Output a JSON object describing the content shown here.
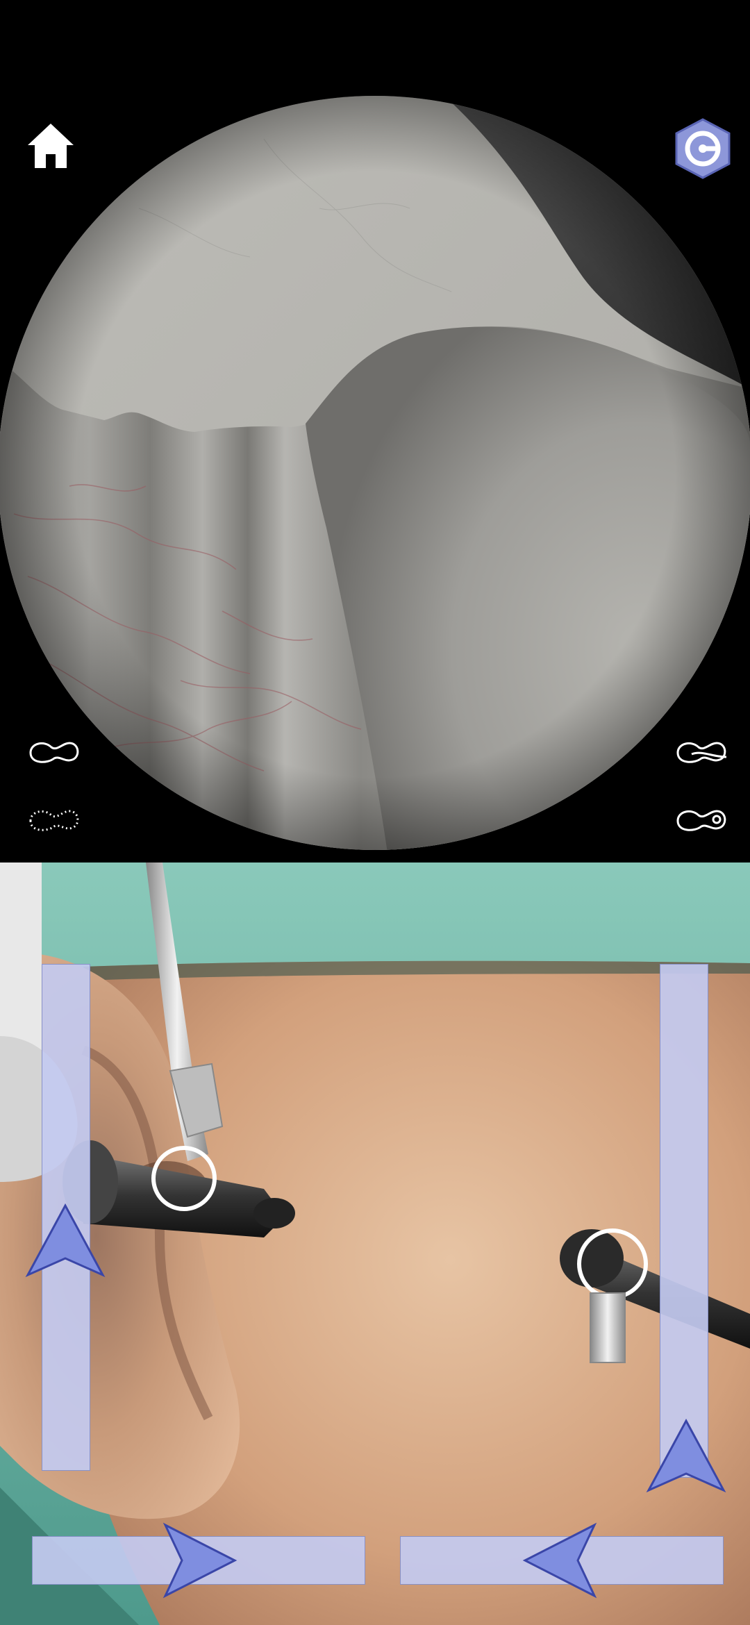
{
  "screen": {
    "name": "ear-endoscopy-simulator"
  },
  "top_view": {
    "home_button": {
      "icon": "home-icon"
    },
    "menu_button": {
      "icon": "hex-logo-icon"
    },
    "controls": [
      {
        "icon": "tool-outline-icon"
      },
      {
        "icon": "tool-dotted-icon"
      },
      {
        "icon": "tool-hook-icon"
      },
      {
        "icon": "tool-loop-icon"
      }
    ]
  },
  "bottom_view": {
    "sliders": [
      {
        "name": "left-vertical-slider",
        "arrow": "up"
      },
      {
        "name": "right-vertical-slider",
        "arrow": "up"
      },
      {
        "name": "left-horizontal-slider",
        "arrow": "right"
      },
      {
        "name": "right-horizontal-slider",
        "arrow": "left"
      }
    ]
  },
  "colors": {
    "slider_fill": "#c3caf0",
    "arrow_fill": "#7f8ee0",
    "arrow_stroke": "#3a46a8",
    "drape_green": "#5aa89a",
    "skin": "#d9ad8c",
    "membrane": "#a8a8a6"
  }
}
